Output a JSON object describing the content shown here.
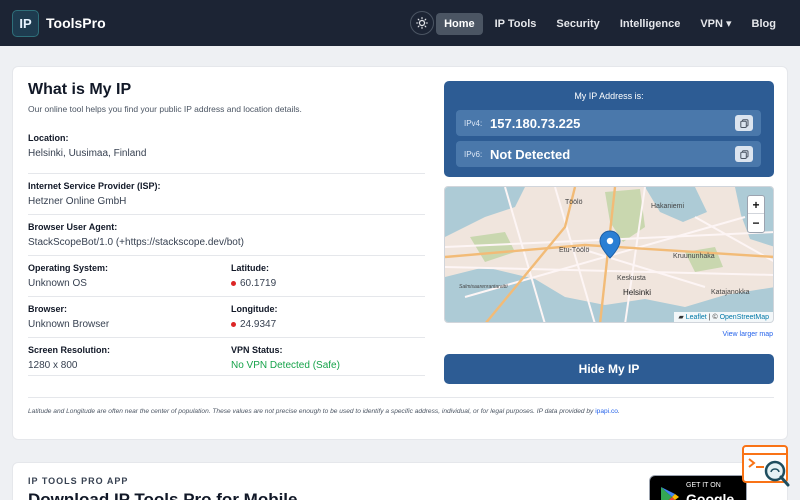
{
  "nav": {
    "logo_mark": "IP",
    "brand": "ToolsPro",
    "links": [
      {
        "label": "Home",
        "active": true
      },
      {
        "label": "IP Tools"
      },
      {
        "label": "Security"
      },
      {
        "label": "Intelligence"
      },
      {
        "label": "VPN ▾"
      },
      {
        "label": "Blog"
      }
    ],
    "theme_icon": "sun-icon"
  },
  "main": {
    "title": "What is My IP",
    "subtitle": "Our online tool helps you find your public IP address and location details.",
    "location_label": "Location:",
    "location_value": "Helsinki, Uusimaa, Finland",
    "isp_label": "Internet Service Provider (ISP):",
    "isp_value": "Hetzner Online GmbH",
    "ua_label": "Browser User Agent:",
    "ua_value": "StackScopeBot/1.0 (+https://stackscope.dev/bot)",
    "os_label": "Operating System:",
    "os_value": "Unknown OS",
    "lat_label": "Latitude:",
    "lat_value": "60.1719",
    "browser_label": "Browser:",
    "browser_value": "Unknown Browser",
    "lon_label": "Longitude:",
    "lon_value": "24.9347",
    "res_label": "Screen Resolution:",
    "res_value": "1280 x 800",
    "vpn_label": "VPN Status:",
    "vpn_value": "No VPN Detected (Safe)",
    "disclaimer": "Latitude and Longitude are often near the center of population. These values are not precise enough to be used to identify a specific address, individual, or for legal purposes. IP data provided by",
    "disclaimer_link": "ipapi.co",
    "disclaimer_end": "."
  },
  "ip_panel": {
    "title": "My IP Address is:",
    "ipv4_label": "IPv4:",
    "ipv4_value": "157.180.73.225",
    "ipv6_label": "IPv6:",
    "ipv6_value": "Not Detected"
  },
  "map": {
    "labels": [
      "Töölö",
      "Hakaniemi",
      "Etu-Töölö",
      "Kruununhaka",
      "Keskusta",
      "Helsinki",
      "Katajanokka",
      "Salmisaarenrantaraitti"
    ],
    "zoom_in": "+",
    "zoom_out": "−",
    "attribution_leaflet": "Leaflet",
    "attribution_sep": " | © ",
    "attribution_osm": "OpenStreetMap",
    "larger_link": "View larger map"
  },
  "hide_button": "Hide My IP",
  "app": {
    "kicker": "IP TOOLS PRO APP",
    "title": "Download IP Tools Pro for Mobile",
    "store_small": "GET IT ON",
    "store_big": "Google Play"
  },
  "colors": {
    "nav_bg": "#1c2434",
    "accent": "#2d5c94",
    "safe": "#16a34a",
    "marker": "#2a7fd4"
  }
}
